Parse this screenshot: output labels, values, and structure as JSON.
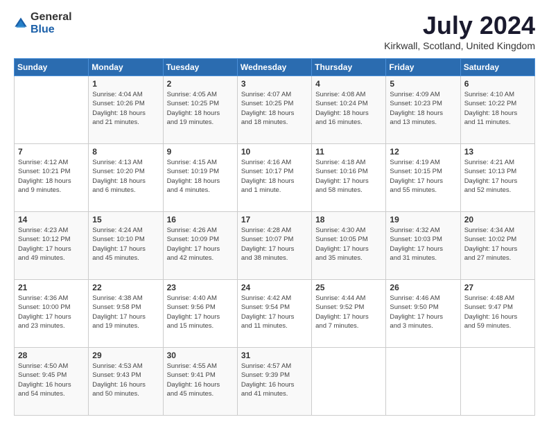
{
  "logo": {
    "general": "General",
    "blue": "Blue"
  },
  "title": "July 2024",
  "subtitle": "Kirkwall, Scotland, United Kingdom",
  "days_header": [
    "Sunday",
    "Monday",
    "Tuesday",
    "Wednesday",
    "Thursday",
    "Friday",
    "Saturday"
  ],
  "weeks": [
    [
      {
        "day": "",
        "info": ""
      },
      {
        "day": "1",
        "info": "Sunrise: 4:04 AM\nSunset: 10:26 PM\nDaylight: 18 hours\nand 21 minutes."
      },
      {
        "day": "2",
        "info": "Sunrise: 4:05 AM\nSunset: 10:25 PM\nDaylight: 18 hours\nand 19 minutes."
      },
      {
        "day": "3",
        "info": "Sunrise: 4:07 AM\nSunset: 10:25 PM\nDaylight: 18 hours\nand 18 minutes."
      },
      {
        "day": "4",
        "info": "Sunrise: 4:08 AM\nSunset: 10:24 PM\nDaylight: 18 hours\nand 16 minutes."
      },
      {
        "day": "5",
        "info": "Sunrise: 4:09 AM\nSunset: 10:23 PM\nDaylight: 18 hours\nand 13 minutes."
      },
      {
        "day": "6",
        "info": "Sunrise: 4:10 AM\nSunset: 10:22 PM\nDaylight: 18 hours\nand 11 minutes."
      }
    ],
    [
      {
        "day": "7",
        "info": "Sunrise: 4:12 AM\nSunset: 10:21 PM\nDaylight: 18 hours\nand 9 minutes."
      },
      {
        "day": "8",
        "info": "Sunrise: 4:13 AM\nSunset: 10:20 PM\nDaylight: 18 hours\nand 6 minutes."
      },
      {
        "day": "9",
        "info": "Sunrise: 4:15 AM\nSunset: 10:19 PM\nDaylight: 18 hours\nand 4 minutes."
      },
      {
        "day": "10",
        "info": "Sunrise: 4:16 AM\nSunset: 10:17 PM\nDaylight: 18 hours\nand 1 minute."
      },
      {
        "day": "11",
        "info": "Sunrise: 4:18 AM\nSunset: 10:16 PM\nDaylight: 17 hours\nand 58 minutes."
      },
      {
        "day": "12",
        "info": "Sunrise: 4:19 AM\nSunset: 10:15 PM\nDaylight: 17 hours\nand 55 minutes."
      },
      {
        "day": "13",
        "info": "Sunrise: 4:21 AM\nSunset: 10:13 PM\nDaylight: 17 hours\nand 52 minutes."
      }
    ],
    [
      {
        "day": "14",
        "info": "Sunrise: 4:23 AM\nSunset: 10:12 PM\nDaylight: 17 hours\nand 49 minutes."
      },
      {
        "day": "15",
        "info": "Sunrise: 4:24 AM\nSunset: 10:10 PM\nDaylight: 17 hours\nand 45 minutes."
      },
      {
        "day": "16",
        "info": "Sunrise: 4:26 AM\nSunset: 10:09 PM\nDaylight: 17 hours\nand 42 minutes."
      },
      {
        "day": "17",
        "info": "Sunrise: 4:28 AM\nSunset: 10:07 PM\nDaylight: 17 hours\nand 38 minutes."
      },
      {
        "day": "18",
        "info": "Sunrise: 4:30 AM\nSunset: 10:05 PM\nDaylight: 17 hours\nand 35 minutes."
      },
      {
        "day": "19",
        "info": "Sunrise: 4:32 AM\nSunset: 10:03 PM\nDaylight: 17 hours\nand 31 minutes."
      },
      {
        "day": "20",
        "info": "Sunrise: 4:34 AM\nSunset: 10:02 PM\nDaylight: 17 hours\nand 27 minutes."
      }
    ],
    [
      {
        "day": "21",
        "info": "Sunrise: 4:36 AM\nSunset: 10:00 PM\nDaylight: 17 hours\nand 23 minutes."
      },
      {
        "day": "22",
        "info": "Sunrise: 4:38 AM\nSunset: 9:58 PM\nDaylight: 17 hours\nand 19 minutes."
      },
      {
        "day": "23",
        "info": "Sunrise: 4:40 AM\nSunset: 9:56 PM\nDaylight: 17 hours\nand 15 minutes."
      },
      {
        "day": "24",
        "info": "Sunrise: 4:42 AM\nSunset: 9:54 PM\nDaylight: 17 hours\nand 11 minutes."
      },
      {
        "day": "25",
        "info": "Sunrise: 4:44 AM\nSunset: 9:52 PM\nDaylight: 17 hours\nand 7 minutes."
      },
      {
        "day": "26",
        "info": "Sunrise: 4:46 AM\nSunset: 9:50 PM\nDaylight: 17 hours\nand 3 minutes."
      },
      {
        "day": "27",
        "info": "Sunrise: 4:48 AM\nSunset: 9:47 PM\nDaylight: 16 hours\nand 59 minutes."
      }
    ],
    [
      {
        "day": "28",
        "info": "Sunrise: 4:50 AM\nSunset: 9:45 PM\nDaylight: 16 hours\nand 54 minutes."
      },
      {
        "day": "29",
        "info": "Sunrise: 4:53 AM\nSunset: 9:43 PM\nDaylight: 16 hours\nand 50 minutes."
      },
      {
        "day": "30",
        "info": "Sunrise: 4:55 AM\nSunset: 9:41 PM\nDaylight: 16 hours\nand 45 minutes."
      },
      {
        "day": "31",
        "info": "Sunrise: 4:57 AM\nSunset: 9:39 PM\nDaylight: 16 hours\nand 41 minutes."
      },
      {
        "day": "",
        "info": ""
      },
      {
        "day": "",
        "info": ""
      },
      {
        "day": "",
        "info": ""
      }
    ]
  ]
}
